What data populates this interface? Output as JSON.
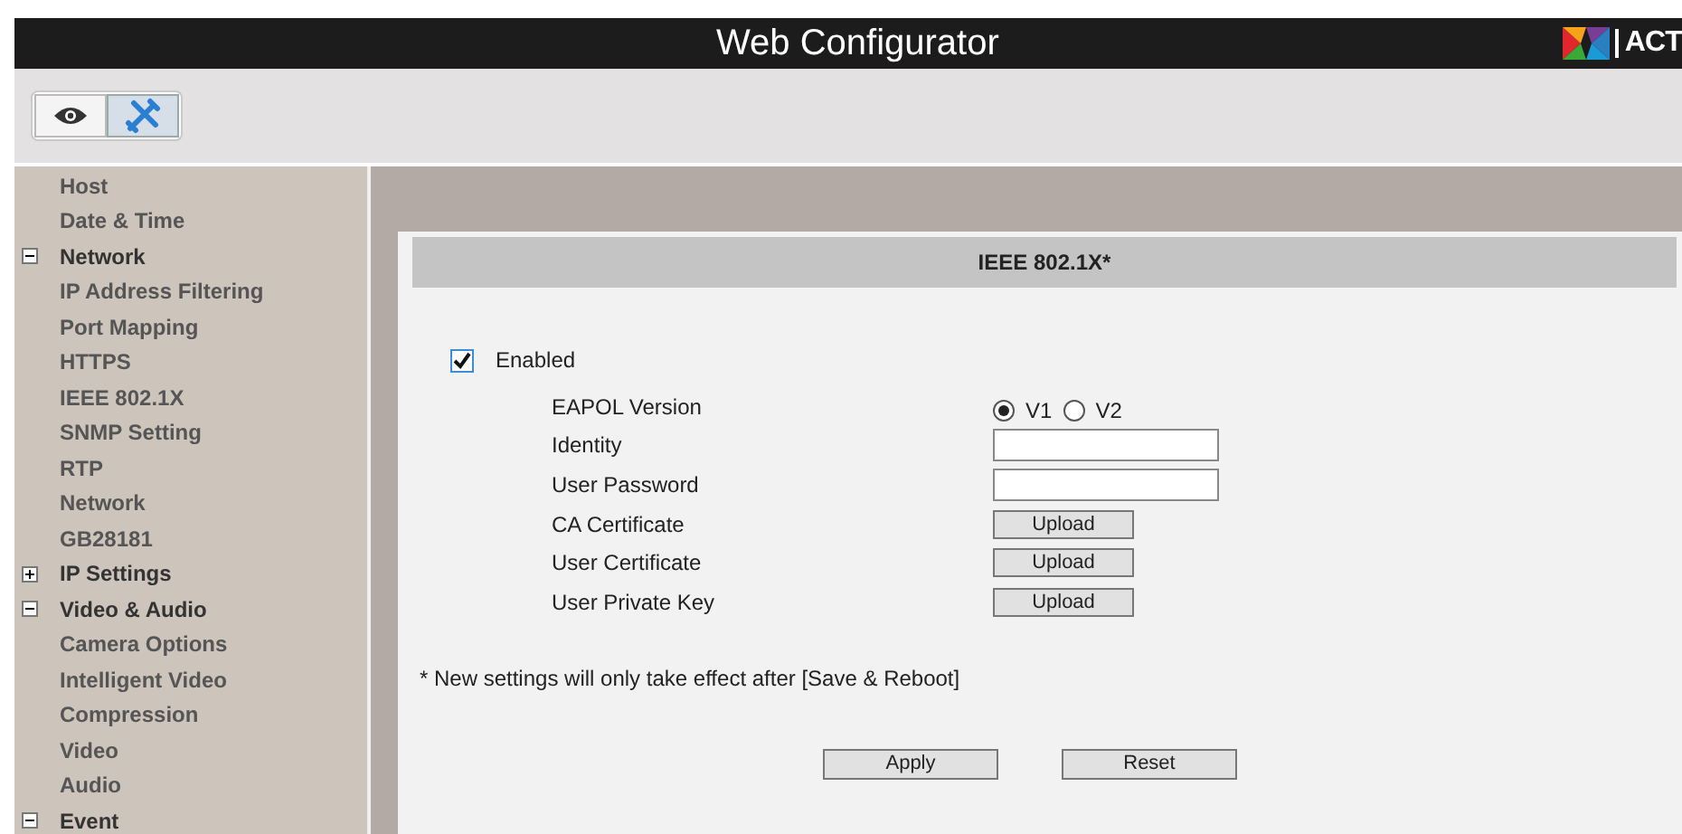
{
  "header": {
    "title": "Web Configurator",
    "logo_text": "ACT"
  },
  "toolbar": [
    {
      "kind": "view",
      "selected": false
    },
    {
      "kind": "setup",
      "selected": true
    }
  ],
  "sidebar": {
    "items": [
      {
        "label": "Host"
      },
      {
        "label": "Date & Time"
      },
      {
        "label": "Network",
        "expanded": true,
        "children": [
          {
            "label": "IP Address Filtering"
          },
          {
            "label": "Port Mapping"
          },
          {
            "label": "HTTPS"
          },
          {
            "label": "IEEE 802.1X"
          },
          {
            "label": "SNMP Setting"
          },
          {
            "label": "RTP"
          },
          {
            "label": "Network"
          },
          {
            "label": "GB28181"
          }
        ]
      },
      {
        "label": "IP Settings",
        "expanded": false
      },
      {
        "label": "Video & Audio",
        "expanded": true,
        "children": [
          {
            "label": "Camera Options"
          },
          {
            "label": "Intelligent Video"
          },
          {
            "label": "Compression"
          },
          {
            "label": "Video"
          },
          {
            "label": "Audio"
          }
        ]
      },
      {
        "label": "Event",
        "expanded": true
      }
    ]
  },
  "panel": {
    "title": "IEEE 802.1X*",
    "enabled": {
      "label": "Enabled",
      "checked": true
    },
    "rows": [
      {
        "kind": "radio",
        "label": "EAPOL Version",
        "options": [
          {
            "label": "V1",
            "selected": true
          },
          {
            "label": "V2",
            "selected": false
          }
        ]
      },
      {
        "kind": "text",
        "label": "Identity"
      },
      {
        "kind": "text",
        "label": "User Password"
      },
      {
        "kind": "upload",
        "label": "CA Certificate",
        "button": "Upload"
      },
      {
        "kind": "upload",
        "label": "User Certificate",
        "button": "Upload"
      },
      {
        "kind": "upload",
        "label": "User Private Key",
        "button": "Upload"
      }
    ],
    "note": "* New settings will only take effect after [Save & Reboot]",
    "buttons": [
      "Apply",
      "Reset"
    ]
  }
}
